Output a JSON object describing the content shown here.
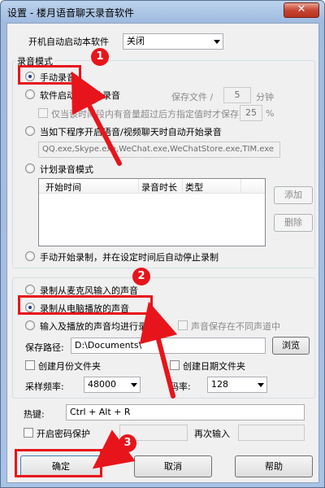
{
  "window": {
    "title": "设置 - 楼月语音聊天录音软件",
    "close_glyph": "✕"
  },
  "autostart": {
    "label": "开机自动启动本软件",
    "value": "关闭"
  },
  "record_mode": {
    "title": "录音模式",
    "manual": "手动录音",
    "auto_start": "软件启动后自动录音",
    "save_label": "保存文件 /",
    "save_value": "5",
    "save_unit": "分钟",
    "threshold_label": "仅当该时间段内有音量超过后方指定值时才保存",
    "threshold_value": "25",
    "threshold_unit": "%",
    "on_program": "当如下程序开启语音/视频聊天时自动开始录音",
    "programs": "QQ.exe,Skype.exe,WeChat.exe,WeChatStore.exe,TIM.exe",
    "schedule": "计划录音模式",
    "columns": [
      "开始时间",
      "录音时长",
      "类型"
    ],
    "add": "添加",
    "delete": "删除",
    "manual_stop": "手动开始录制，并在设定时间后自动停止录制"
  },
  "source": {
    "mic": "录制从麦克风输入的声音",
    "pc": "录制从电脑播放的声音",
    "both": "输入及播放的声音均进行录制",
    "separate": "声音保存在不同声道中",
    "path_label": "保存路径:",
    "path_value": "D:\\Documents\\",
    "browse": "浏览",
    "month_folder": "创建月份文件夹",
    "date_folder": "创建日期文件夹",
    "sample_label": "采样频率:",
    "sample_value": "48000",
    "bitrate_label": "码率:",
    "bitrate_value": "128"
  },
  "hotkey": {
    "label": "热键:",
    "value": "Ctrl + Alt + R"
  },
  "password": {
    "label": "开启密码保护",
    "again": "再次输入"
  },
  "buttons": {
    "ok": "确定",
    "cancel": "取消",
    "help": "帮助"
  },
  "badges": [
    "1",
    "2",
    "3"
  ],
  "colors": {
    "annotation": "#e8141b",
    "title_bar": "#a9c3e6"
  }
}
